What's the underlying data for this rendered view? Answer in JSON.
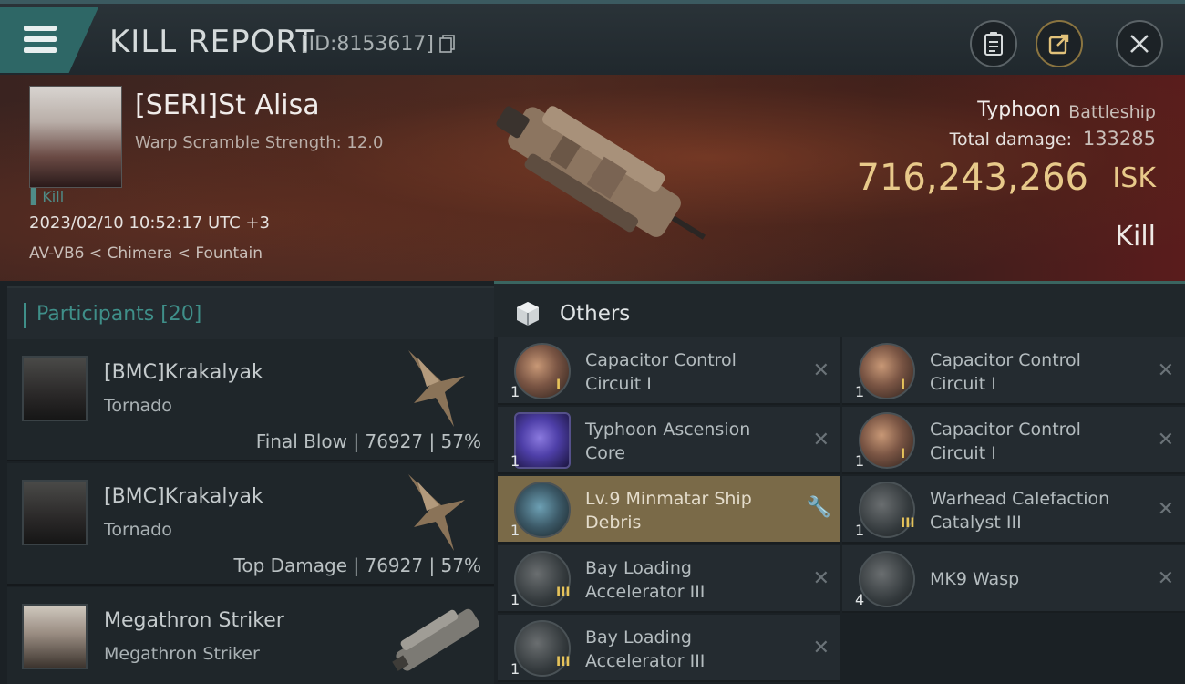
{
  "header": {
    "title": "KILL REPORT",
    "report_id": "[ID:8153617]"
  },
  "victim": {
    "name": "[SERI]St Alisa",
    "warp_scramble": "Warp Scramble Strength: 12.0",
    "kill_tag": "Kill",
    "datetime": "2023/02/10 10:52:17 UTC +3",
    "location": "AV-VB6 < Chimera < Fountain",
    "ship_name": "Typhoon",
    "ship_class": "Battleship",
    "total_damage_label": "Total damage:",
    "total_damage": "133285",
    "isk_value": "716,243,266",
    "isk_unit": "ISK",
    "result": "Kill"
  },
  "participants": {
    "label": "Participants [20]",
    "rows": [
      {
        "name": "[BMC]Krakalyak",
        "ship": "Tornado",
        "stat": "Final Blow | 76927 | 57%"
      },
      {
        "name": "[BMC]Krakalyak",
        "ship": "Tornado",
        "stat": "Top Damage | 76927 | 57%"
      },
      {
        "name": "Megathron Striker",
        "ship": "Megathron Striker",
        "stat": ""
      }
    ]
  },
  "others": {
    "label": "Others",
    "left": [
      {
        "name": "Capacitor Control Circuit I",
        "qty": "1",
        "tier": "I",
        "icon": "capacitor-icon"
      },
      {
        "name": "Typhoon Ascension Core",
        "qty": "1",
        "tier": "",
        "icon": "core-icon"
      },
      {
        "name": "Lv.9 Minmatar Ship Debris",
        "qty": "1",
        "tier": "",
        "icon": "debris-icon"
      },
      {
        "name": "Bay Loading Accelerator III",
        "qty": "1",
        "tier": "III",
        "icon": "accelerator-icon"
      },
      {
        "name": "Bay Loading Accelerator III",
        "qty": "1",
        "tier": "III",
        "icon": "accelerator-icon"
      }
    ],
    "right": [
      {
        "name": "Capacitor Control Circuit I",
        "qty": "1",
        "tier": "I",
        "icon": "capacitor-icon"
      },
      {
        "name": "Capacitor Control Circuit I",
        "qty": "1",
        "tier": "I",
        "icon": "capacitor-icon"
      },
      {
        "name": "Warhead Calefaction Catalyst III",
        "qty": "1",
        "tier": "III",
        "icon": "catalyst-icon"
      },
      {
        "name": "MK9 Wasp",
        "qty": "4",
        "tier": "",
        "icon": "drone-icon"
      }
    ]
  },
  "colors": {
    "accent_teal": "#3f8f89",
    "isk_gold": "#e8c98a",
    "highlight_row": "#7a6a48"
  }
}
